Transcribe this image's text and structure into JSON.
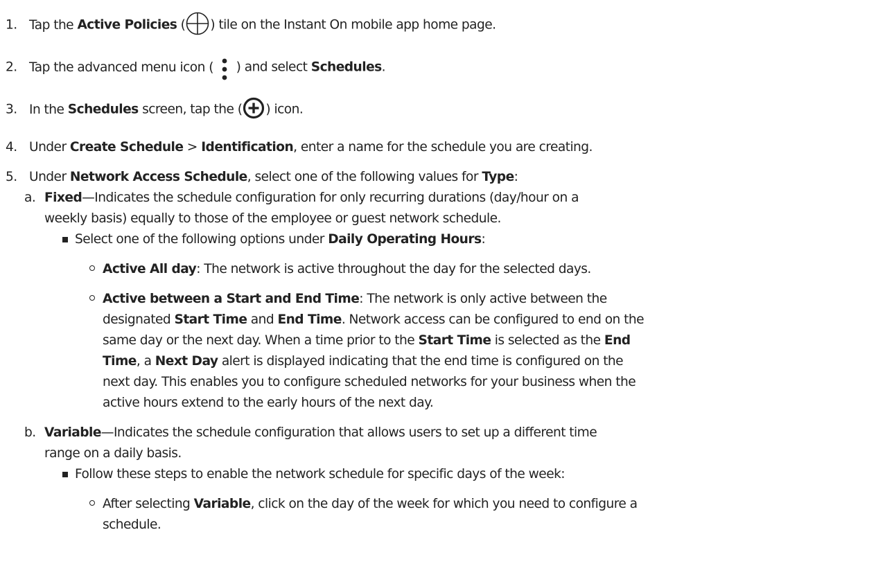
{
  "steps": [
    {
      "num": "1.",
      "pre": "Tap the ",
      "bold": "Active Policies",
      "mid": " (",
      "icon": "active-policies-tile-icon",
      "post": ") tile on the Instant On mobile app home page."
    },
    {
      "num": "2.",
      "pre": "Tap the advanced menu icon ( ",
      "icon": "vertical-ellipsis-menu-icon",
      "mid": " ) and select ",
      "bold": "Schedules",
      "post": "."
    },
    {
      "num": "3.",
      "pre": "In the ",
      "bold": "Schedules",
      "mid": " screen, tap the (",
      "icon": "circle-plus-icon",
      "post": ") icon."
    },
    {
      "num": "4.",
      "pre": "Under ",
      "bold1": "Create Schedule",
      "mid": " > ",
      "bold2": "Identification",
      "post": ", enter a name for the schedule you are creating."
    },
    {
      "num": "5.",
      "pre": "Under ",
      "bold1": "Network Access Schedule",
      "mid": ", select one of the following values for ",
      "bold2": "Type",
      "post": ":"
    }
  ],
  "fixed": {
    "letter": "a.",
    "term": "Fixed",
    "line1": "—Indicates the schedule configuration for only recurring durations (day/hour on a",
    "line2": "weekly basis) equally to those of the employee or guest network schedule.",
    "bullet": {
      "pre": "Select one of the following options under ",
      "bold": "Daily Operating Hours",
      "post": ":"
    },
    "option1": {
      "bold": "Active All day",
      "text": ": The network is active throughout the day for the selected days."
    },
    "option2": {
      "bold": "Active between a Start and End Time",
      "text": ": The network is only active between the",
      "l2_pre": "designated ",
      "l2_b1": "Start Time",
      "l2_mid": " and ",
      "l2_b2": "End Time",
      "l2_post": ". Network access can be configured to end on the",
      "l3_pre": "same day or the next day. When a time prior to the ",
      "l3_b1": "Start Time",
      "l3_mid": " is selected as the ",
      "l3_b2": "End",
      "l4_b1": "Time",
      "l4_mid": ", a ",
      "l4_b2": "Next Day",
      "l4_post": " alert is displayed indicating that the end time is configured on the",
      "l5": "next day. This enables you to configure scheduled networks for your business when the",
      "l6": "active hours extend to the early hours of the next day."
    }
  },
  "variable": {
    "letter": "b.",
    "term": "Variable",
    "line1": "—Indicates the schedule configuration that allows users to set up a different time",
    "line2": "range on a daily basis.",
    "bullet": "Follow these steps to enable the network schedule for specific days of the week:",
    "sub": {
      "pre": "After selecting ",
      "bold": "Variable",
      "post": ", click on the day of the week for which you need to configure a",
      "line2": "schedule."
    }
  }
}
